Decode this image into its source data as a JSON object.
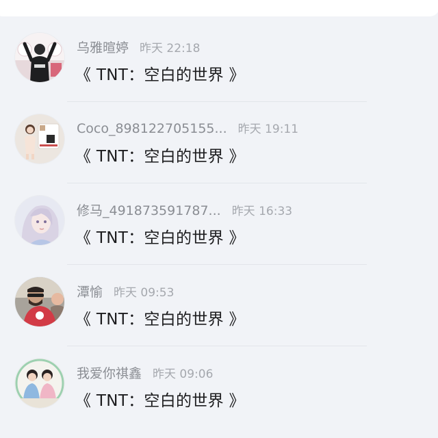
{
  "comments": [
    {
      "user": "乌雅暄婷",
      "time": "昨天 22:18",
      "text": "《 TNT：空白的世界 》"
    },
    {
      "user": "Coco_898122705155...",
      "time": "昨天 19:11",
      "text": "《 TNT：空白的世界 》"
    },
    {
      "user": "修马_491873591787...",
      "time": "昨天 16:33",
      "text": "《 TNT：空白的世界 》"
    },
    {
      "user": "潭愉",
      "time": "昨天 09:53",
      "text": "《 TNT：空白的世界 》"
    },
    {
      "user": "我爱你祺鑫",
      "time": "昨天 09:06",
      "text": "《 TNT：空白的世界 》"
    }
  ],
  "colors": {
    "accent": "#3d8cf0",
    "name_text": "#8a8d93",
    "time_text": "#a5a8ae",
    "comment_text": "#1c1c1e",
    "background": "#f1f3f7"
  }
}
